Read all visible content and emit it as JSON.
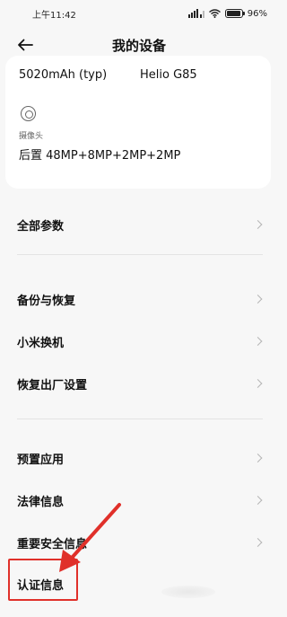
{
  "status_bar": {
    "time": "上午11:42",
    "battery": "96",
    "battery_level": 0.96
  },
  "header": {
    "title": "我的设备"
  },
  "specs": {
    "battery_capacity": "5020mAh (typ)",
    "processor": "Helio G85",
    "camera_label": "摄像头",
    "camera_value": "后置 48MP+8MP+2MP+2MP"
  },
  "menu": {
    "all_params": "全部参数",
    "backup_restore": "备份与恢复",
    "mi_mover": "小米换机",
    "factory_reset": "恢复出厂设置",
    "preinstalled_apps": "预置应用",
    "legal_info": "法律信息",
    "safety_info": "重要安全信息",
    "certification": "认证信息"
  },
  "colors": {
    "background": "#f7f7f7",
    "card": "#ffffff",
    "annotation": "#e0302a"
  },
  "icons": [
    "back-arrow-icon",
    "camera-icon",
    "chevron-right-icon",
    "wifi-icon",
    "signal-icon",
    "battery-icon"
  ]
}
